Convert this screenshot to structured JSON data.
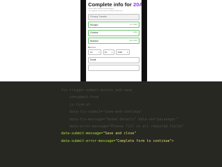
{
  "form": {
    "title_prefix": "Complete info for ",
    "title_accent": "20A",
    "notes": [
      "Please add or remove account (bag x)",
      "The complete account have to continue button (ok)"
    ],
    "fields": [
      {
        "value": "Primary Traveler",
        "hint": "",
        "state": "muted"
      },
      {
        "value": "Richard",
        "hint": "ok / visible",
        "state": "valid"
      },
      {
        "value": "Charles",
        "hint": "visible",
        "state": "valid"
      },
      {
        "value": "Brasson",
        "hint": "also visible",
        "state": "valid"
      }
    ],
    "dob": {
      "label": "Born on",
      "month": "Jul",
      "day": "10",
      "year": "1990"
    },
    "email": {
      "value": "Email"
    },
    "phone_number": {
      "value": ""
    }
  },
  "code": {
    "dim_lines": [
      "fis-trigger-submit-button_and-save",
      "    id=submit-form",
      "    js-link-bl",
      "    data-fis-submit=\"save-and-continue\"",
      "    data-fis-message=\"Saved details\" data-ok=\"passenger\"",
      "    data-error-message=\"Please fill in all required fields\""
    ],
    "submit_message_attr": "data-submit-message=",
    "submit_message_value": "\"Save and close\"",
    "submit_error_attr": "data-submit-error-message=",
    "submit_error_value": "\"Complete form to continue\">"
  },
  "colors": {
    "accent": "#8a3fd6",
    "valid_border": "#69c56d",
    "code_background": "#272822",
    "code_string": "#e6db74"
  }
}
